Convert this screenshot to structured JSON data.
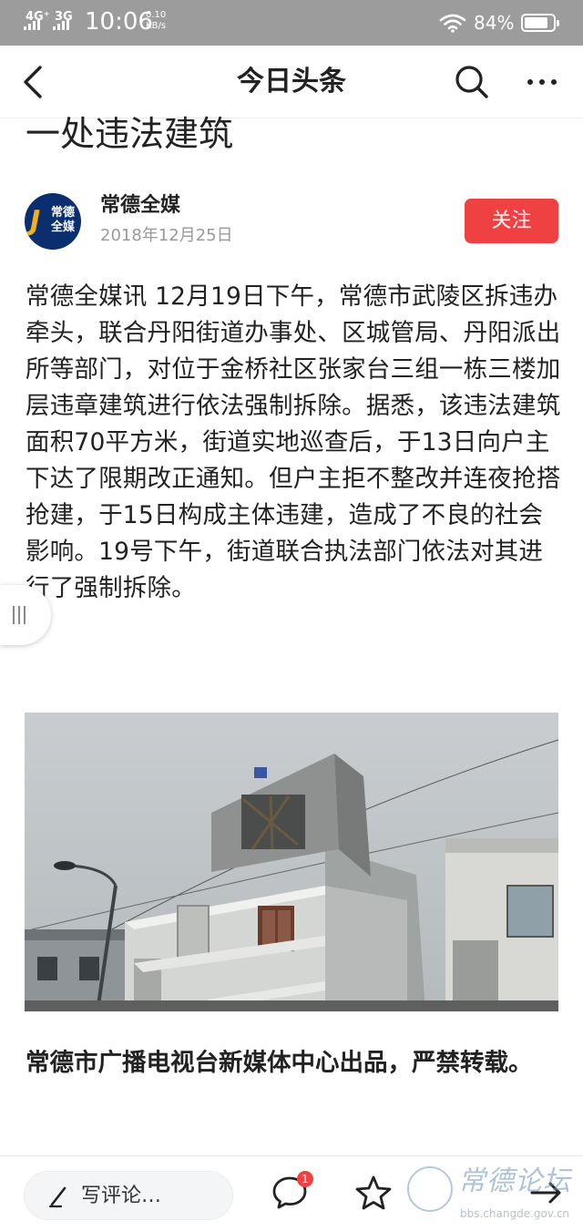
{
  "status_bar": {
    "signal_1": "4G⁺",
    "signal_2": "3G",
    "time": "10:06",
    "net_speed_value": "0.10",
    "net_speed_unit": "KB/s",
    "battery": "84%",
    "battery_level": 0.84
  },
  "header": {
    "title": "今日头条",
    "back_icon": "chevron-left-icon",
    "search_icon": "search-icon",
    "more_icon": "more-dots-icon"
  },
  "article": {
    "title_visible": "一处违法建筑",
    "author": {
      "name": "常德全媒",
      "date": "2018年12月25日",
      "follow_label": "关注",
      "avatar_text_1": "常德",
      "avatar_text_2": "全媒"
    },
    "body": "常德全媒讯 12月19日下午，常德市武陵区拆违办牵头，联合丹阳街道办事处、区城管局、丹阳派出所等部门，对位于金桥社区张家台三组一栋三楼加层违章建筑进行依法强制拆除。据悉，该违法建筑面积70平方米，街道实地巡查后，于13日向户主下达了限期改正通知。但户主拒不整改并连夜抢搭抢建，于15日构成主体违建，造成了不良的社会影响。19号下午，街道联合执法部门依法对其进行了强制拆除。",
    "caption": "常德市广播电视台新媒体中心出品，严禁转载。"
  },
  "bottom_bar": {
    "comment_placeholder": "写评论…",
    "comment_count": "1",
    "comment_icon": "comment-bubble-icon",
    "star_icon": "star-icon",
    "share_icon": "share-arrow-icon"
  },
  "watermark": {
    "text": "常德论坛",
    "url": "bbs.changde.gov.cn"
  },
  "colors": {
    "status_bar": "#9c9c9c",
    "accent": "#f04142",
    "avatar_bg": "#0b2f6e"
  }
}
